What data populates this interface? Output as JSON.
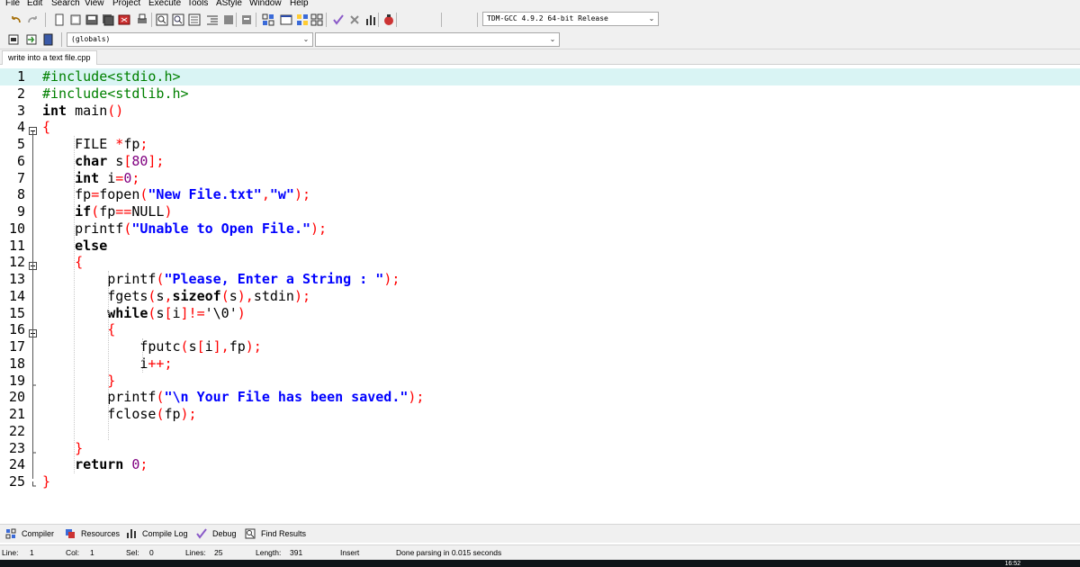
{
  "menu": [
    "File",
    "Edit",
    "Search",
    "View",
    "Project",
    "Execute",
    "Tools",
    "AStyle",
    "Window",
    "Help"
  ],
  "toolbar": {
    "compiler_select": "TDM-GCC 4.9.2 64-bit Release",
    "globals_select": "(globals)",
    "members_select": "",
    "icons": [
      "undo-icon",
      "redo-icon",
      "new-file-icon",
      "open-icon",
      "save-icon",
      "save-all-icon",
      "close-icon",
      "print-icon",
      "find-icon",
      "replace-icon",
      "goto-icon",
      "indent-icon",
      "unindent-icon",
      "toggle-comment-icon",
      "compile-icon",
      "run-icon",
      "compile-run-icon",
      "rebuild-icon",
      "syntax-check-icon",
      "stop-icon",
      "profile-icon",
      "debug-icon"
    ]
  },
  "file_tab": "write into a text file.cpp",
  "editor": {
    "current_line": 1,
    "lines": [
      {
        "n": "1",
        "tokens": [
          [
            "pre",
            "#include<stdio.h>"
          ]
        ]
      },
      {
        "n": "2",
        "tokens": [
          [
            "pre",
            "#include<stdlib.h>"
          ]
        ]
      },
      {
        "n": "3",
        "tokens": [
          [
            "kw",
            "int"
          ],
          [
            "id",
            " main"
          ],
          [
            "sym",
            "()"
          ]
        ]
      },
      {
        "n": "4",
        "tokens": [
          [
            "sym",
            "{"
          ]
        ]
      },
      {
        "n": "5",
        "tokens": [
          [
            "id",
            "    FILE "
          ],
          [
            "sym",
            "*"
          ],
          [
            "id",
            "fp"
          ],
          [
            "sym",
            ";"
          ]
        ]
      },
      {
        "n": "6",
        "tokens": [
          [
            "id",
            "    "
          ],
          [
            "kw",
            "char"
          ],
          [
            "id",
            " s"
          ],
          [
            "sym",
            "["
          ],
          [
            "num",
            "80"
          ],
          [
            "sym",
            "];"
          ]
        ]
      },
      {
        "n": "7",
        "tokens": [
          [
            "id",
            "    "
          ],
          [
            "kw",
            "int"
          ],
          [
            "id",
            " i"
          ],
          [
            "sym",
            "="
          ],
          [
            "num",
            "0"
          ],
          [
            "sym",
            ";"
          ]
        ]
      },
      {
        "n": "8",
        "tokens": [
          [
            "id",
            "    fp"
          ],
          [
            "sym",
            "="
          ],
          [
            "id",
            "fopen"
          ],
          [
            "sym",
            "("
          ],
          [
            "str",
            "\"New File.txt\""
          ],
          [
            "sym",
            ","
          ],
          [
            "str",
            "\"w\""
          ],
          [
            "sym",
            ");"
          ]
        ]
      },
      {
        "n": "9",
        "tokens": [
          [
            "id",
            "    "
          ],
          [
            "kw",
            "if"
          ],
          [
            "sym",
            "("
          ],
          [
            "id",
            "fp"
          ],
          [
            "sym",
            "=="
          ],
          [
            "id",
            "NULL"
          ],
          [
            "sym",
            ")"
          ]
        ]
      },
      {
        "n": "10",
        "tokens": [
          [
            "id",
            "    printf"
          ],
          [
            "sym",
            "("
          ],
          [
            "str",
            "\"Unable to Open File.\""
          ],
          [
            "sym",
            ");"
          ]
        ]
      },
      {
        "n": "11",
        "tokens": [
          [
            "id",
            "    "
          ],
          [
            "kw",
            "else"
          ]
        ]
      },
      {
        "n": "12",
        "tokens": [
          [
            "id",
            "    "
          ],
          [
            "sym",
            "{"
          ]
        ]
      },
      {
        "n": "13",
        "tokens": [
          [
            "id",
            "        printf"
          ],
          [
            "sym",
            "("
          ],
          [
            "str",
            "\"Please, Enter a String : \""
          ],
          [
            "sym",
            ");"
          ]
        ]
      },
      {
        "n": "14",
        "tokens": [
          [
            "id",
            "        fgets"
          ],
          [
            "sym",
            "("
          ],
          [
            "id",
            "s"
          ],
          [
            "sym",
            ","
          ],
          [
            "kw",
            "sizeof"
          ],
          [
            "sym",
            "("
          ],
          [
            "id",
            "s"
          ],
          [
            "sym",
            "),"
          ],
          [
            "id",
            "stdin"
          ],
          [
            "sym",
            ");"
          ]
        ]
      },
      {
        "n": "15",
        "tokens": [
          [
            "id",
            "        "
          ],
          [
            "kw",
            "while"
          ],
          [
            "sym",
            "("
          ],
          [
            "id",
            "s"
          ],
          [
            "sym",
            "["
          ],
          [
            "id",
            "i"
          ],
          [
            "sym",
            "]!="
          ],
          [
            "id",
            "'\\0'"
          ],
          [
            "sym",
            ")"
          ]
        ]
      },
      {
        "n": "16",
        "tokens": [
          [
            "id",
            "        "
          ],
          [
            "sym",
            "{"
          ]
        ]
      },
      {
        "n": "17",
        "tokens": [
          [
            "id",
            "            fputc"
          ],
          [
            "sym",
            "("
          ],
          [
            "id",
            "s"
          ],
          [
            "sym",
            "["
          ],
          [
            "id",
            "i"
          ],
          [
            "sym",
            "],"
          ],
          [
            "id",
            "fp"
          ],
          [
            "sym",
            ");"
          ]
        ]
      },
      {
        "n": "18",
        "tokens": [
          [
            "id",
            "            i"
          ],
          [
            "sym",
            "++;"
          ]
        ]
      },
      {
        "n": "19",
        "tokens": [
          [
            "id",
            "        "
          ],
          [
            "sym",
            "}"
          ]
        ]
      },
      {
        "n": "20",
        "tokens": [
          [
            "id",
            "        printf"
          ],
          [
            "sym",
            "("
          ],
          [
            "str",
            "\"\\n Your File has been saved.\""
          ],
          [
            "sym",
            ");"
          ]
        ]
      },
      {
        "n": "21",
        "tokens": [
          [
            "id",
            "        fclose"
          ],
          [
            "sym",
            "("
          ],
          [
            "id",
            "fp"
          ],
          [
            "sym",
            ");"
          ]
        ]
      },
      {
        "n": "22",
        "tokens": []
      },
      {
        "n": "23",
        "tokens": [
          [
            "id",
            "    "
          ],
          [
            "sym",
            "}"
          ]
        ]
      },
      {
        "n": "24",
        "tokens": [
          [
            "id",
            "    "
          ],
          [
            "kw",
            "return"
          ],
          [
            "id",
            " "
          ],
          [
            "num",
            "0"
          ],
          [
            "sym",
            ";"
          ]
        ]
      },
      {
        "n": "25",
        "tokens": [
          [
            "sym",
            "}"
          ]
        ]
      }
    ]
  },
  "bottom_tabs": [
    {
      "label": "Compiler",
      "icon": "compiler-grid-icon"
    },
    {
      "label": "Resources",
      "icon": "resources-icon"
    },
    {
      "label": "Compile Log",
      "icon": "compile-log-chart-icon"
    },
    {
      "label": "Debug",
      "icon": "debug-check-icon"
    },
    {
      "label": "Find Results",
      "icon": "find-results-icon"
    }
  ],
  "status": {
    "line_label": "Line:",
    "line_value": "1",
    "col_label": "Col:",
    "col_value": "1",
    "sel_label": "Sel:",
    "sel_value": "0",
    "lines_label": "Lines:",
    "lines_value": "25",
    "length_label": "Length:",
    "length_value": "391",
    "mode": "Insert",
    "message": "Done parsing in 0.015 seconds"
  },
  "clock": "16:52",
  "colors": {
    "preprocessor": "#008000",
    "symbol": "#ff0000",
    "string": "#0000ff",
    "number": "#800080",
    "current_line": "#d9f4f4"
  }
}
